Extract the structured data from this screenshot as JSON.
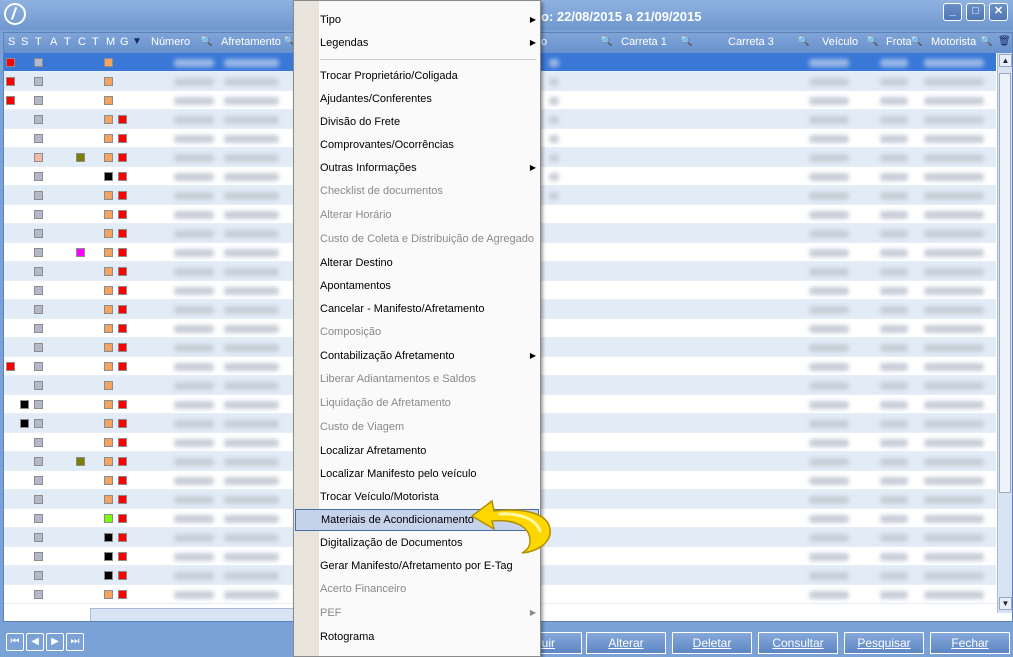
{
  "window": {
    "title": "o: 22/08/2015 a 21/09/2015",
    "controls": [
      "_",
      "□",
      "✕"
    ]
  },
  "grid": {
    "columns": [
      "S",
      "S",
      "T",
      "A",
      "T",
      "C",
      "T",
      "M",
      "G",
      "Número",
      "Afretamento",
      "o",
      "Carreta 1",
      "Carreta 3",
      "Veículo",
      "Frota",
      "Motorista"
    ],
    "colors": {
      "red": "#ff0000",
      "gray_ind": "#b4b8cc",
      "orange_ind": "#f4a460",
      "olive": "#808000",
      "magenta": "#ff00ff",
      "black": "#000000",
      "green": "#7cfc00",
      "pink": "#f4b8a8"
    }
  },
  "context_menu": {
    "items": [
      {
        "label": "Tipo",
        "disabled": false,
        "submenu": true
      },
      {
        "label": "Legendas",
        "disabled": false,
        "submenu": true
      },
      {
        "label": "Trocar Proprietário/Coligada",
        "disabled": false
      },
      {
        "label": "Ajudantes/Conferentes",
        "disabled": false
      },
      {
        "label": "Divisão do Frete",
        "disabled": false
      },
      {
        "label": "Comprovantes/Ocorrências",
        "disabled": false
      },
      {
        "label": "Outras Informações",
        "disabled": false,
        "submenu": true
      },
      {
        "label": "Checklist de documentos",
        "disabled": true
      },
      {
        "label": "Alterar Horário",
        "disabled": true
      },
      {
        "label": "Custo de Coleta e Distribuição de Agregado",
        "disabled": true
      },
      {
        "label": "Alterar Destino",
        "disabled": false
      },
      {
        "label": "Apontamentos",
        "disabled": false
      },
      {
        "label": "Cancelar - Manifesto/Afretamento",
        "disabled": false
      },
      {
        "label": "Composição",
        "disabled": true
      },
      {
        "label": "Contabilização Afretamento",
        "disabled": false,
        "submenu": true
      },
      {
        "label": "Liberar Adiantamentos e Saldos",
        "disabled": true
      },
      {
        "label": "Liquidação de Afretamento",
        "disabled": true
      },
      {
        "label": "Custo de Viagem",
        "disabled": true
      },
      {
        "label": "Localizar Afretamento",
        "disabled": false
      },
      {
        "label": "Localizar Manifesto pelo veículo",
        "disabled": false
      },
      {
        "label": "Trocar Veículo/Motorista",
        "disabled": false
      },
      {
        "label": "Materiais de Acondicionamento",
        "disabled": false,
        "highlighted": true
      },
      {
        "label": "Digitalização de Documentos",
        "disabled": false
      },
      {
        "label": "Gerar Manifesto/Afretamento por E-Tag",
        "disabled": false
      },
      {
        "label": "Acerto Financeiro",
        "disabled": true
      },
      {
        "label": "PEF",
        "disabled": true,
        "submenu": true
      },
      {
        "label": "Rotograma",
        "disabled": false
      }
    ]
  },
  "bottom": {
    "nav": [
      "⏮",
      "◀",
      "▶",
      "⏭"
    ],
    "buttons": [
      "luir",
      "Alterar",
      "Deletar",
      "Consultar",
      "Pesquisar",
      "Fechar"
    ]
  },
  "accent": "#ffd700"
}
